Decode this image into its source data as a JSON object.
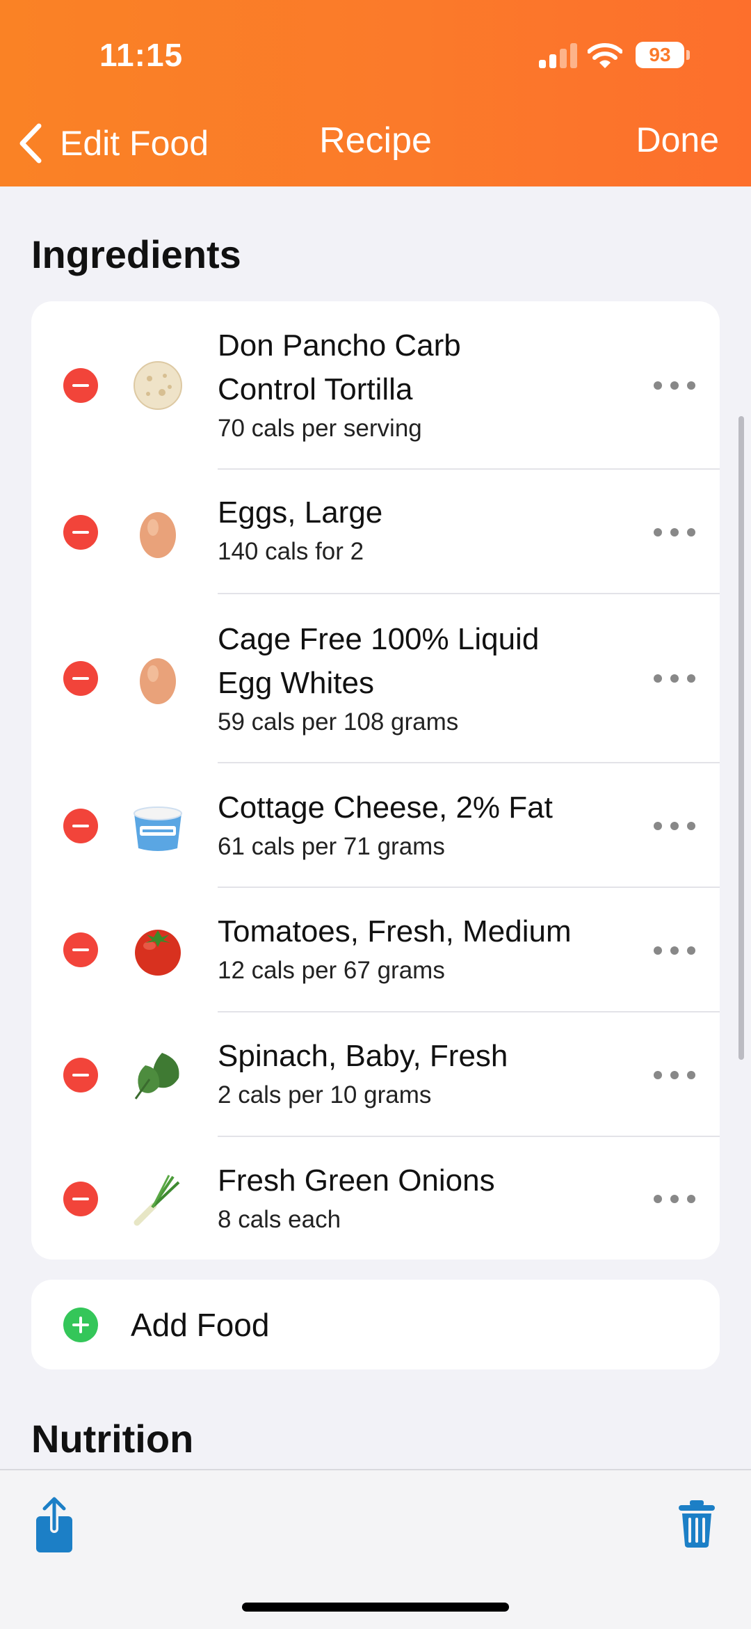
{
  "status_bar": {
    "time": "11:15",
    "battery": "93"
  },
  "nav": {
    "back_label": "Edit Food",
    "title": "Recipe",
    "done_label": "Done"
  },
  "sections": {
    "ingredients": "Ingredients",
    "nutrition": "Nutrition"
  },
  "ingredients": [
    {
      "name_lines": [
        "Don Pancho Carb",
        "Control Tortilla"
      ],
      "cals": "70 cals per serving",
      "icon": "tortilla-icon"
    },
    {
      "name_lines": [
        "Eggs, Large"
      ],
      "cals": "140 cals for 2",
      "icon": "egg-icon"
    },
    {
      "name_lines": [
        "Cage Free 100% Liquid",
        "Egg Whites"
      ],
      "cals": "59 cals per 108 grams",
      "icon": "egg-icon"
    },
    {
      "name_lines": [
        "Cottage Cheese, 2% Fat"
      ],
      "cals": "61 cals per 71 grams",
      "icon": "cottage-cheese-icon"
    },
    {
      "name_lines": [
        "Tomatoes, Fresh, Medium"
      ],
      "cals": "12 cals per 67 grams",
      "icon": "tomato-icon"
    },
    {
      "name_lines": [
        "Spinach, Baby, Fresh"
      ],
      "cals": "2 cals per 10 grams",
      "icon": "spinach-icon"
    },
    {
      "name_lines": [
        "Fresh Green Onions"
      ],
      "cals": "8 cals each",
      "icon": "green-onion-icon"
    }
  ],
  "add_food": {
    "label": "Add Food"
  },
  "toolbar": {
    "share_icon": "share-icon",
    "trash_icon": "trash-icon"
  },
  "colors": {
    "header_start": "#fa8225",
    "header_end": "#fd6f2c",
    "remove_red": "#f2443a",
    "add_green": "#34c659",
    "toolbar_blue": "#1c7fc6"
  }
}
